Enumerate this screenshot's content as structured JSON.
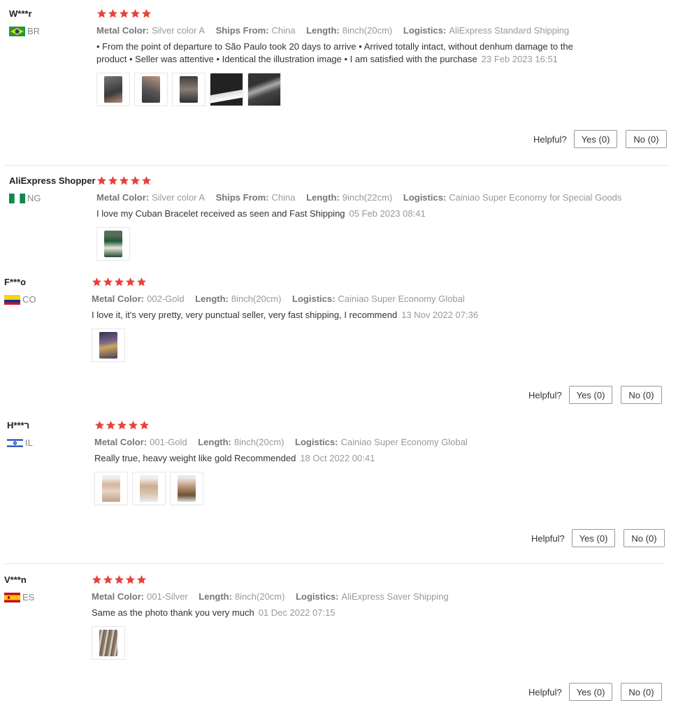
{
  "props_labels": {
    "color": "Metal Color:",
    "ships": "Ships From:",
    "length": "Length:",
    "logistics": "Logistics:"
  },
  "helpful_label": "Helpful?",
  "star_color": "#e8413b",
  "reviews": [
    {
      "user": "W***r",
      "country": "BR",
      "rating": 5,
      "color": "Silver color A",
      "ships": "China",
      "length": "8inch(20cm)",
      "logistics": "AliExpress Standard Shipping",
      "text": "• From the point of departure to São Paulo took 20 days to arrive • Arrived totally intact, without denhum damage to the product • Seller was attentive • Identical the illustration image • I am satisfied with the purchase",
      "date": "23 Feb 2023 16:51",
      "yes": "Yes (0)",
      "no": "No (0)"
    },
    {
      "user": "AliExpress Shopper",
      "country": "NG",
      "rating": 5,
      "color": "Silver color A",
      "ships": "China",
      "length": "9inch(22cm)",
      "logistics": "Cainiao Super Economy for Special Goods",
      "text": "I love my Cuban Bracelet received as seen and Fast Shipping",
      "date": "05 Feb 2023 08:41"
    },
    {
      "user": "F***o",
      "country": "CO",
      "rating": 5,
      "color": "002-Gold",
      "length": "8inch(20cm)",
      "logistics": "Cainiao Super Economy Global",
      "text": "I love it, it's very pretty, very punctual seller, very fast shipping, I recommend",
      "date": "13 Nov 2022 07:36",
      "yes": "Yes (0)",
      "no": "No (0)"
    },
    {
      "user": "H***ר",
      "country": "IL",
      "rating": 5,
      "color": "001-Gold",
      "length": "8inch(20cm)",
      "logistics": "Cainiao Super Economy Global",
      "text": "Really true, heavy weight like gold Recommended",
      "date": "18 Oct 2022 00:41",
      "yes": "Yes (0)",
      "no": "No (0)"
    },
    {
      "user": "V***n",
      "country": "ES",
      "rating": 5,
      "color": "001-Silver",
      "length": "8inch(20cm)",
      "logistics": "AliExpress Saver Shipping",
      "text": "Same as the photo thank you very much",
      "date": "01 Dec 2022 07:15",
      "yes": "Yes (0)",
      "no": "No (0)"
    }
  ]
}
